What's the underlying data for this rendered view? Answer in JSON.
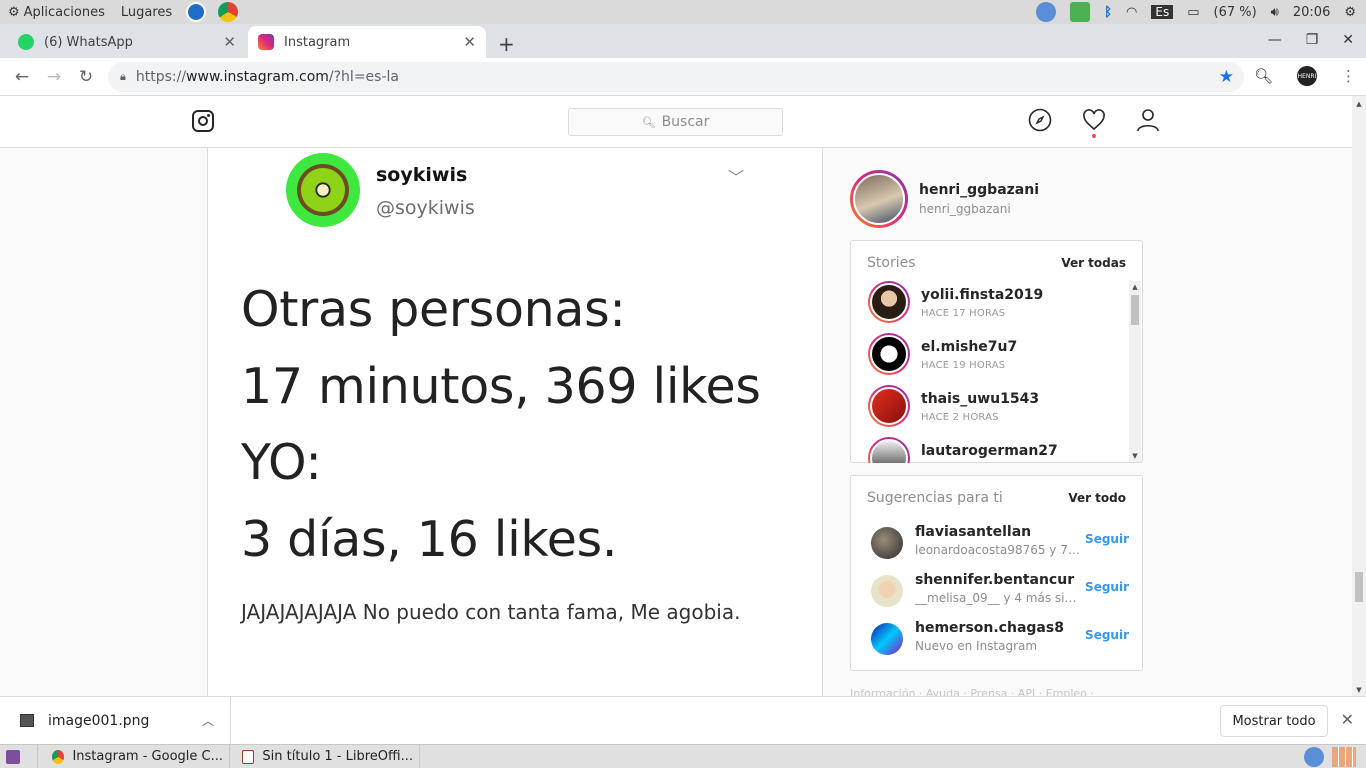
{
  "system_bar": {
    "menu_apps": "Aplicaciones",
    "menu_places": "Lugares",
    "keyboard_layout": "Es",
    "battery": "(67 %)",
    "clock": "20:06"
  },
  "tabs": [
    {
      "title": "(6) WhatsApp",
      "badge": "6",
      "favicon": "whatsapp-icon"
    },
    {
      "title": "Instagram",
      "favicon": "instagram-icon"
    }
  ],
  "omnibox": {
    "scheme": "https://",
    "host": "www.instagram.com",
    "path": "/?hl=es-la"
  },
  "profile_chip": "HENRI",
  "instagram": {
    "search_placeholder": "Buscar",
    "post": {
      "tweet_display_name": "soykiwis",
      "tweet_handle": "@soykiwis",
      "lines": [
        "Otras personas:",
        "17 minutos, 369 likes",
        "YO:",
        "3 días, 16 likes."
      ],
      "footer": "JAJAJAJAJAJA No puedo con tanta fama, Me agobia."
    },
    "profile": {
      "username": "henri_ggbazani",
      "full_name": "henri_ggbazani"
    },
    "stories": {
      "header": "Stories",
      "see_all": "Ver todas",
      "items": [
        {
          "user": "yolii.finsta2019",
          "time": "HACE 17 HORAS"
        },
        {
          "user": "el.mishe7u7",
          "time": "HACE 19 HORAS"
        },
        {
          "user": "thais_uwu1543",
          "time": "HACE 2 HORAS"
        },
        {
          "user": "lautarogerman27",
          "time": ""
        }
      ]
    },
    "suggestions": {
      "header": "Sugerencias para ti",
      "see_all": "Ver todo",
      "follow_label": "Seguir",
      "items": [
        {
          "user": "flaviasantellan",
          "sub": "leonardoacosta98765 y 7 m..."
        },
        {
          "user": "shennifer.bentancur",
          "sub": "__melisa_09__ y 4 más sigu..."
        },
        {
          "user": "hemerson.chagas8",
          "sub": "Nuevo en Instagram"
        }
      ]
    },
    "footer_links": "Información · Ayuda · Prensa · API · Empleo ·"
  },
  "downloads": {
    "file": "image001.png",
    "show_all": "Mostrar todo"
  },
  "taskbar": {
    "items": [
      "Instagram - Google C...",
      "Sin título 1 - LibreOffi..."
    ]
  }
}
